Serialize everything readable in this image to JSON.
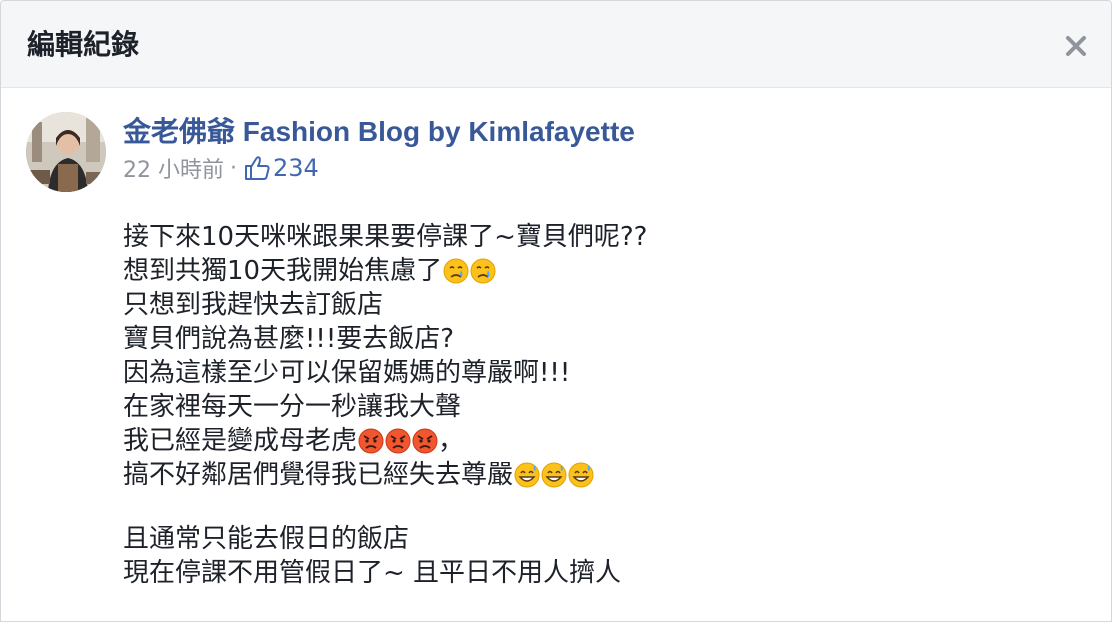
{
  "dialog": {
    "title": "編輯紀錄"
  },
  "post": {
    "author": "金老佛爺 Fashion Blog by Kimlafayette",
    "time": "22 小時前",
    "separator": "·",
    "like_count": "234",
    "lines": [
      "接下來10天咪咪跟果果要停課了~寶貝們呢??",
      "想到共獨10天我開始焦慮了",
      "只想到我趕快去訂飯店",
      "寶貝們說為甚麼!!!要去飯店?",
      "因為這樣至少可以保留媽媽的尊嚴啊!!!",
      "在家裡每天一分一秒讓我大聲",
      "我已經是變成母老虎",
      "搞不好鄰居們覺得我已經失去尊嚴",
      "且通常只能去假日的飯店",
      "現在停課不用管假日了~ 且平日不用人擠人"
    ],
    "line7_suffix": "，",
    "emojis": {
      "line2": "crying-face",
      "line7": "angry-face",
      "line8": "grinning-sweat-face"
    }
  },
  "colors": {
    "author": "#385898",
    "meta": "#90949c",
    "like": "#4267b2",
    "text": "#1d2129",
    "header_bg": "#f5f6f7"
  }
}
